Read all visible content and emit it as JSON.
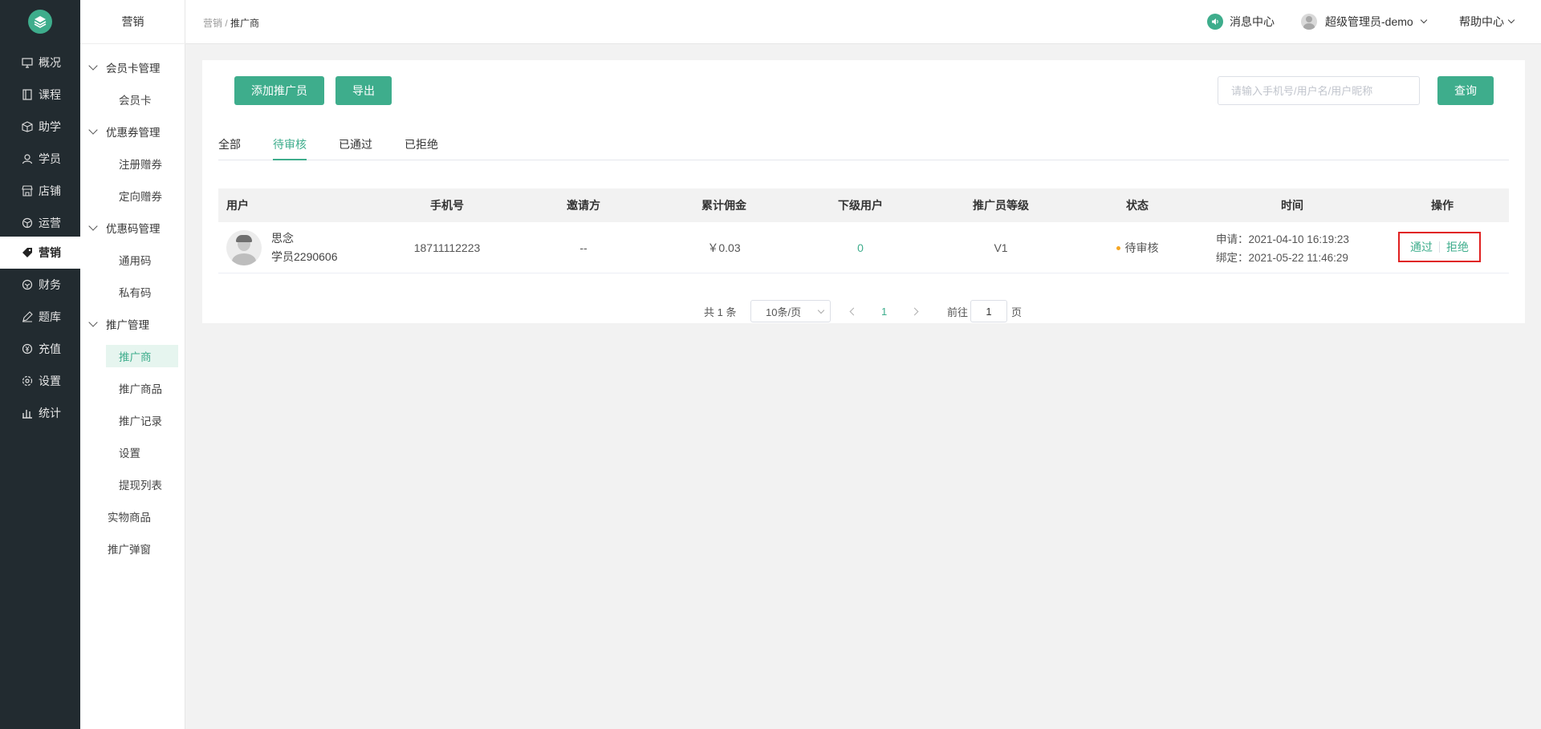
{
  "nav": {
    "items": [
      {
        "label": "概况",
        "icon": "monitor-icon"
      },
      {
        "label": "课程",
        "icon": "book-icon"
      },
      {
        "label": "助学",
        "icon": "box-icon"
      },
      {
        "label": "学员",
        "icon": "user-icon"
      },
      {
        "label": "店铺",
        "icon": "store-icon"
      },
      {
        "label": "运营",
        "icon": "cube-icon"
      },
      {
        "label": "营销",
        "icon": "tag-icon",
        "active": true
      },
      {
        "label": "财务",
        "icon": "wallet-icon"
      },
      {
        "label": "题库",
        "icon": "pen-icon"
      },
      {
        "label": "充值",
        "icon": "yen-icon"
      },
      {
        "label": "设置",
        "icon": "gear-icon"
      },
      {
        "label": "统计",
        "icon": "bar-chart-icon"
      }
    ]
  },
  "subnav": {
    "title": "营销",
    "groups": [
      {
        "label": "会员卡管理",
        "items": [
          "会员卡"
        ]
      },
      {
        "label": "优惠券管理",
        "items": [
          "注册赠券",
          "定向赠券"
        ]
      },
      {
        "label": "优惠码管理",
        "items": [
          "通用码",
          "私有码"
        ]
      },
      {
        "label": "推广管理",
        "items": [
          "推广商",
          "推广商品",
          "推广记录",
          "设置",
          "提现列表"
        ]
      }
    ],
    "extra": [
      "实物商品",
      "推广弹窗"
    ],
    "active": "推广商"
  },
  "header": {
    "crumb_parent": "营销",
    "crumb_sep": "/",
    "crumb_current": "推广商",
    "messages": "消息中心",
    "user": "超级管理员-demo",
    "help": "帮助中心"
  },
  "toolbar": {
    "add_label": "添加推广员",
    "export_label": "导出",
    "search_placeholder": "请输入手机号/用户名/用户昵称",
    "query_label": "查询"
  },
  "tabs": [
    "全部",
    "待审核",
    "已通过",
    "已拒绝"
  ],
  "active_tab": "待审核",
  "table": {
    "headers": [
      "用户",
      "手机号",
      "邀请方",
      "累计佣金",
      "下级用户",
      "推广员等级",
      "状态",
      "时间",
      "操作"
    ],
    "rows": [
      {
        "name": "思念",
        "account": "学员2290606",
        "phone": "18711112223",
        "inviter": "--",
        "commission": "￥0.03",
        "sub_users": "0",
        "level": "V1",
        "status": "待审核",
        "apply_time": "申请：2021-04-10 16:19:23",
        "bind_time": "绑定：2021-05-22 11:46:29",
        "approve": "通过",
        "reject": "拒绝"
      }
    ]
  },
  "pagination": {
    "total": "共 1 条",
    "page_size": "10条/页",
    "current": "1",
    "goto_label": "前往",
    "goto_value": "1",
    "page_unit": "页"
  },
  "colors": {
    "accent": "#3ead8c",
    "nav_bg": "#222b30",
    "pending": "#f5a623",
    "highlight": "#e02020"
  }
}
